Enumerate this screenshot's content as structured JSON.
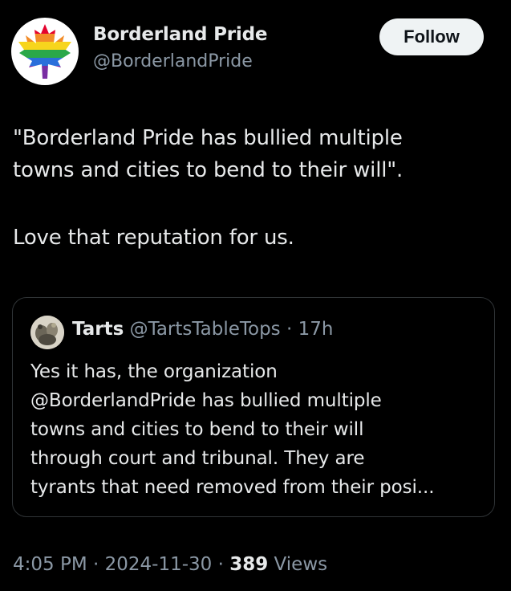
{
  "author": {
    "display_name": "Borderland Pride",
    "handle": "@BorderlandPride",
    "avatar_icon": "rainbow-maple-leaf-icon"
  },
  "follow_label": "Follow",
  "tweet": {
    "lines": [
      "\"Borderland Pride has bullied multiple",
      "towns and cities to bend to their will\"."
    ],
    "second_paragraph": "Love that reputation for us."
  },
  "quote": {
    "display_name": "Tarts",
    "handle_time": "@TartsTableTops · 17h",
    "avatar_icon": "tabletop-miniatures-avatar",
    "lines": [
      "Yes it has, the organization",
      "@BorderlandPride has bullied multiple",
      "towns and cities to bend to their will",
      "through court and tribunal. They are",
      "tyrants that need removed from their posi..."
    ]
  },
  "footer": {
    "time_date": "4:05 PM · 2024-11-30 · ",
    "views_count": "389",
    "views_label": " Views"
  },
  "colors": {
    "background": "#000000",
    "primary_text": "#e7e9ea",
    "secondary_text": "#8b98a5",
    "follow_bg": "#eff3f4",
    "border": "#2f3336"
  }
}
